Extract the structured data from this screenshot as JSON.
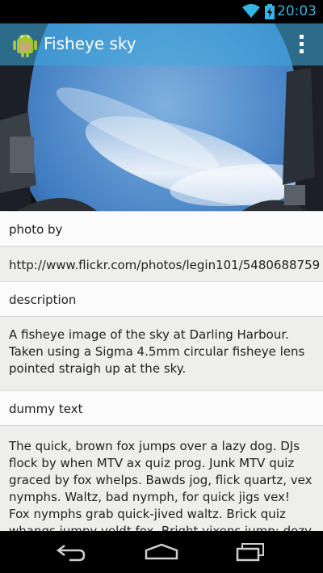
{
  "status": {
    "time": "20:03",
    "wifi_icon": "wifi-icon",
    "battery_icon": "battery-charging-icon",
    "accent": "#33b5e5"
  },
  "action_bar": {
    "title": "Fisheye sky",
    "app_icon": "android-icon",
    "overflow_icon": "overflow-menu-icon"
  },
  "hero_image": {
    "subject": "fisheye sky photo"
  },
  "sections": [
    {
      "header": "photo by",
      "body": "http://www.flickr.com/photos/legin101/5480688759"
    },
    {
      "header": "description",
      "body": "A fisheye image of the sky at Darling Harbour. Taken using a Sigma 4.5mm circular fisheye lens pointed straigh up at the sky."
    },
    {
      "header": "dummy text",
      "body": "The quick, brown fox jumps over a lazy dog. DJs flock by when MTV ax quiz prog. Junk MTV quiz graced by fox whelps. Bawds jog, flick quartz, vex nymphs. Waltz, bad nymph, for quick jigs vex! Fox nymphs grab quick-jived waltz. Brick quiz whangs jumpy veldt fox. Bright vixens jump; dozy fowl quack. Quick wafting zephyrs vex bold Jim. Quick zephyrs blow, vexing daft"
    }
  ],
  "nav_bar": {
    "back_icon": "back-icon",
    "home_icon": "home-icon",
    "recents_icon": "recents-icon"
  }
}
